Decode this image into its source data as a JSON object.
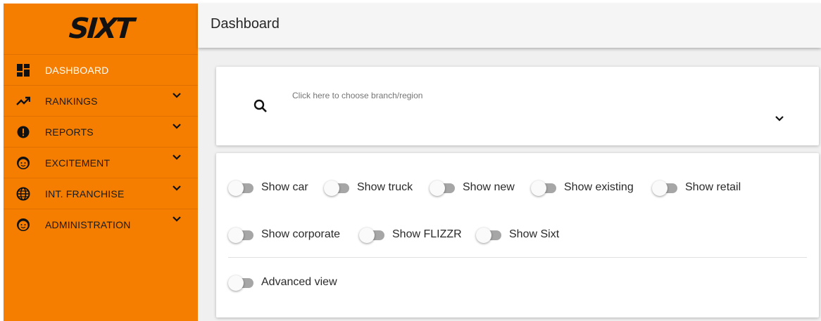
{
  "brand": {
    "logo": "SIXT"
  },
  "header": {
    "title": "Dashboard"
  },
  "sidebar": {
    "items": [
      {
        "label": "DASHBOARD",
        "icon": "dashboard-icon",
        "active": true,
        "expandable": false
      },
      {
        "label": "RANKINGS",
        "icon": "trending-up-icon",
        "active": false,
        "expandable": true
      },
      {
        "label": "REPORTS",
        "icon": "alert-circle-icon",
        "active": false,
        "expandable": true
      },
      {
        "label": "EXCITEMENT",
        "icon": "smiley-face-icon",
        "active": false,
        "expandable": true
      },
      {
        "label": "INT. FRANCHISE",
        "icon": "globe-icon",
        "active": false,
        "expandable": true
      },
      {
        "label": "ADMINISTRATION",
        "icon": "smiley-face-icon",
        "active": false,
        "expandable": true
      }
    ]
  },
  "search": {
    "placeholder": "Click here to choose branch/region",
    "value": ""
  },
  "toggles": {
    "row1": [
      "Show car",
      "Show truck",
      "Show new",
      "Show existing",
      "Show retail"
    ],
    "row2": [
      "Show corporate",
      "Show FLIZZR",
      "Show Sixt"
    ],
    "advanced": "Advanced view"
  },
  "colors": {
    "sidebar": "#f57e00",
    "active_label": "#ffffff",
    "header_bg": "#f5f5f5",
    "toggle_track": "#a6a6a6"
  }
}
